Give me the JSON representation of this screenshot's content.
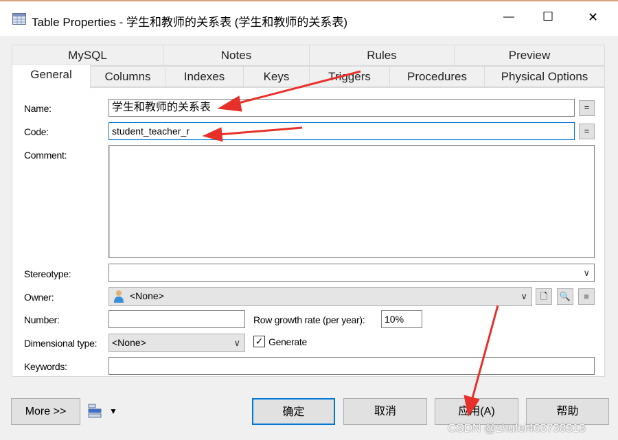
{
  "window": {
    "title": "Table Properties - 学生和教师的关系表 (学生和教师的关系表)",
    "minimize": "—",
    "maximize": "☐",
    "close": "✕"
  },
  "tabs_row1": [
    "MySQL",
    "Notes",
    "Rules",
    "Preview"
  ],
  "tabs_row2": [
    "General",
    "Columns",
    "Indexes",
    "Keys",
    "Triggers",
    "Procedures",
    "Physical Options"
  ],
  "form": {
    "name_label": "Name:",
    "name_value": "学生和教师的关系表",
    "code_label": "Code:",
    "code_value": "student_teacher_r",
    "eq": "=",
    "comment_label": "Comment:",
    "comment_value": "",
    "stereotype_label": "Stereotype:",
    "stereotype_value": "",
    "owner_label": "Owner:",
    "owner_value": "<None>",
    "number_label": "Number:",
    "number_value": "",
    "growth_label": "Row growth rate (per year):",
    "growth_value": "10%",
    "dimensional_label": "Dimensional type:",
    "dimensional_value": "<None>",
    "generate_label": "Generate",
    "generate_checked": true,
    "keywords_label": "Keywords:",
    "keywords_value": ""
  },
  "buttons": {
    "more": "More >>",
    "ok": "确定",
    "cancel": "取消",
    "apply": "应用(A)",
    "help": "帮助"
  },
  "watermark": "CSDN @zhufei463738313",
  "annotation_color": "#e8302a"
}
